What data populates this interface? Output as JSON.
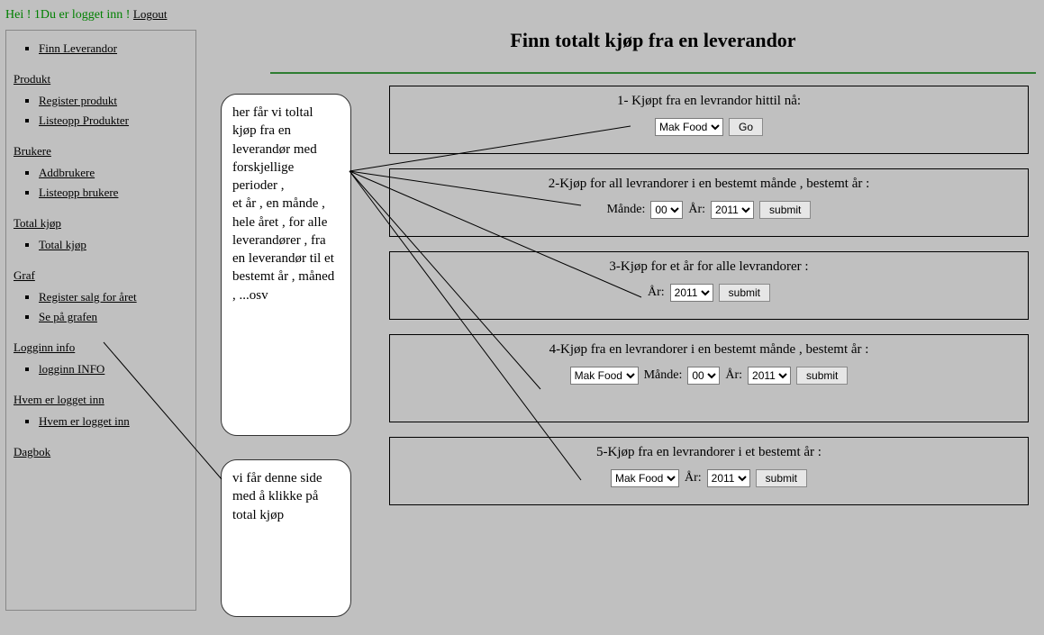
{
  "header": {
    "greeting": "Hei ! 1Du er logget inn !",
    "logout": "Logout"
  },
  "sidebar": {
    "items": [
      {
        "type": "link",
        "label": "Finn Leverandor"
      },
      {
        "type": "section",
        "label": "Produkt"
      },
      {
        "type": "link",
        "label": "Register produkt"
      },
      {
        "type": "link",
        "label": "Listeopp Produkter"
      },
      {
        "type": "section",
        "label": "Brukere"
      },
      {
        "type": "link",
        "label": "Addbrukere"
      },
      {
        "type": "link",
        "label": "Listeopp brukere"
      },
      {
        "type": "section",
        "label": "Total kjøp"
      },
      {
        "type": "link",
        "label": "Total kjøp"
      },
      {
        "type": "section",
        "label": "Graf"
      },
      {
        "type": "link",
        "label": "Register salg for året"
      },
      {
        "type": "link",
        "label": "Se på grafen"
      },
      {
        "type": "section",
        "label": "Logginn info"
      },
      {
        "type": "link",
        "label": "logginn INFO"
      },
      {
        "type": "section",
        "label": "Hvem er logget inn"
      },
      {
        "type": "link",
        "label": "Hvem er logget inn"
      },
      {
        "type": "section",
        "label": "Dagbok"
      }
    ]
  },
  "title": "Finn totalt kjøp fra en leverandor",
  "note1": "her får vi toltal kjøp fra en leverandør med forskjellige perioder ,\net år , en månde , hele året , for alle leverandører , fra en leverandør til et bestemt  år , måned , ...osv",
  "note2": "vi får denne side  med å klikke på total kjøp",
  "panels": {
    "p1": {
      "label": "1- Kjøpt fra en levrandor hittil nå:",
      "supplier": "Mak Food",
      "button": "Go"
    },
    "p2": {
      "label": "2-Kjøp for all levrandorer i en bestemt månde , bestemt år :",
      "mande_label": "Månde:",
      "mande_value": "00",
      "ar_label": "År:",
      "ar_value": "2011",
      "button": "submit"
    },
    "p3": {
      "label": "3-Kjøp for et år for alle levrandorer :",
      "ar_label": "År:",
      "ar_value": "2011",
      "button": "submit"
    },
    "p4": {
      "label": "4-Kjøp fra en levrandorer i en bestemt månde , bestemt år :",
      "supplier": "Mak Food",
      "mande_label": "Månde:",
      "mande_value": "00",
      "ar_label": "År:",
      "ar_value": "2011",
      "button": "submit"
    },
    "p5": {
      "label": "5-Kjøp fra en levrandorer i et bestemt år :",
      "supplier": "Mak Food",
      "ar_label": "År:",
      "ar_value": "2011",
      "button": "submit"
    }
  }
}
